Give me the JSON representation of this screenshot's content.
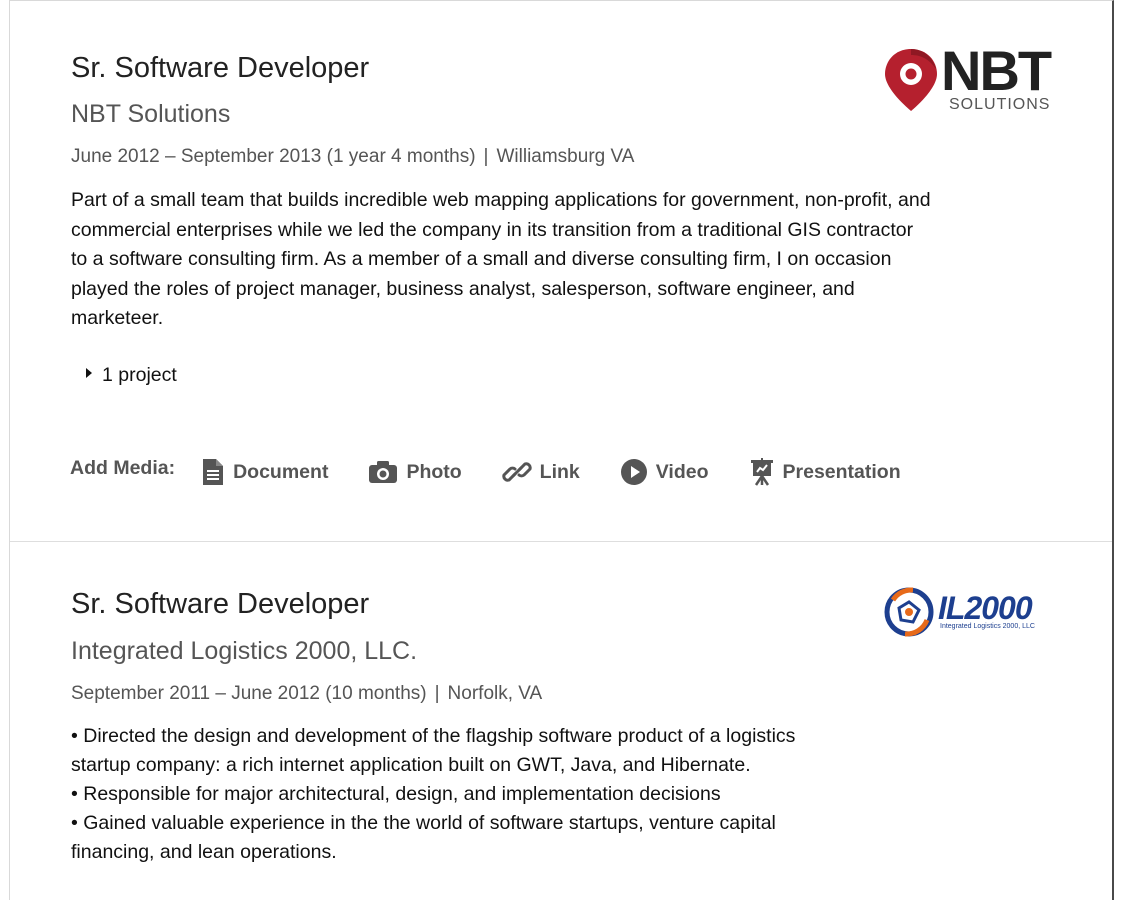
{
  "entries": [
    {
      "title": "Sr. Software Developer",
      "company": "NBT Solutions",
      "dates": "June 2012 – September 2013 (1 year 4 months)",
      "separator": "|",
      "location": "Williamsburg VA",
      "description_lines": [
        "Part of a small team that builds incredible web mapping applications for government, non-profit, and",
        "commercial enterprises while we led the company in its transition from a traditional GIS contractor",
        "to a software consulting firm. As a member of a small and diverse consulting firm, I on occasion",
        "played the roles of project manager, business analyst, salesperson, software engineer, and",
        "marketeer."
      ],
      "projects_toggle": "1 project",
      "logo": {
        "name": "NBT",
        "sub": "SOLUTIONS",
        "pin_color": "#b5202e"
      }
    },
    {
      "title": "Sr. Software Developer",
      "company": "Integrated Logistics 2000, LLC.",
      "dates": "September 2011 – June 2012 (10 months)",
      "separator": "|",
      "location": "Norfolk, VA",
      "bullets": [
        "• Directed the design and development of the flagship software product of a logistics",
        "startup company: a rich internet application built on GWT, Java, and Hibernate.",
        "• Responsible for major architectural, design, and implementation decisions",
        "• Gained valuable experience in the the world of software startups, venture capital",
        "financing, and lean operations."
      ],
      "logo": {
        "name": "IL2000",
        "sub": "Integrated Logistics 2000, LLC",
        "color": "#1d3f8f",
        "accent": "#e76a1a"
      }
    }
  ],
  "add_media": {
    "label": "Add Media:",
    "buttons": [
      {
        "label": "Document",
        "icon": "document-icon"
      },
      {
        "label": "Photo",
        "icon": "camera-icon"
      },
      {
        "label": "Link",
        "icon": "link-icon"
      },
      {
        "label": "Video",
        "icon": "play-icon"
      },
      {
        "label": "Presentation",
        "icon": "presentation-icon"
      }
    ]
  }
}
